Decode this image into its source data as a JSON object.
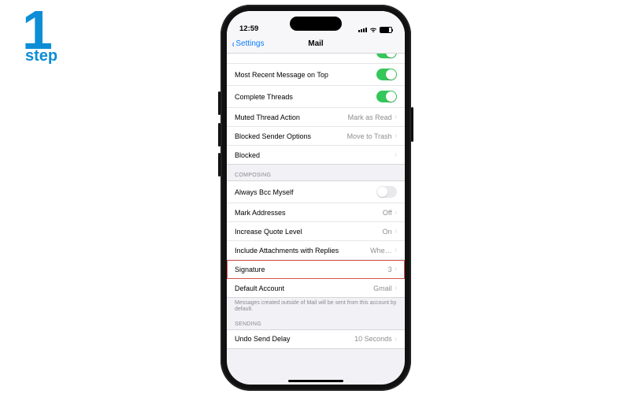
{
  "badge": {
    "digit": "1",
    "word": "step"
  },
  "status": {
    "time": "12:59"
  },
  "nav": {
    "back": "Settings",
    "title": "Mail"
  },
  "threading": {
    "rows": [
      {
        "label": "Most Recent Message on Top",
        "type": "toggle",
        "on": true
      },
      {
        "label": "Complete Threads",
        "type": "toggle",
        "on": true
      },
      {
        "label": "Muted Thread Action",
        "type": "value",
        "value": "Mark as Read"
      },
      {
        "label": "Blocked Sender Options",
        "type": "value",
        "value": "Move to Trash"
      },
      {
        "label": "Blocked",
        "type": "link"
      }
    ]
  },
  "composing": {
    "header": "Composing",
    "rows": [
      {
        "label": "Always Bcc Myself",
        "type": "toggle",
        "on": false
      },
      {
        "label": "Mark Addresses",
        "type": "value",
        "value": "Off"
      },
      {
        "label": "Increase Quote Level",
        "type": "value",
        "value": "On"
      },
      {
        "label": "Include Attachments with Replies",
        "type": "value",
        "value": "Whe…"
      },
      {
        "label": "Signature",
        "type": "value",
        "value": "3",
        "highlight": true
      },
      {
        "label": "Default Account",
        "type": "value",
        "value": "Gmail"
      }
    ],
    "footer": "Messages created outside of Mail will be sent from this account by default."
  },
  "sending": {
    "header": "Sending",
    "rows": [
      {
        "label": "Undo Send Delay",
        "type": "value",
        "value": "10 Seconds"
      }
    ]
  }
}
